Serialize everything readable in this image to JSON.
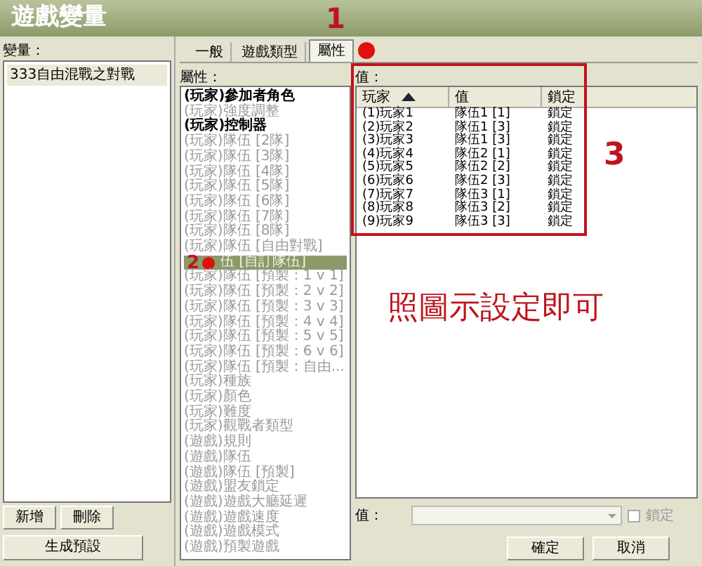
{
  "window": {
    "title": "遊戲變量"
  },
  "variables": {
    "label": "變量：",
    "items": [
      {
        "text": "333自由混戰之對戰",
        "selected": true
      }
    ],
    "buttons": [
      "新增",
      "刪除"
    ],
    "generate_button": "生成預設"
  },
  "tabs": [
    {
      "label": "一般",
      "selected": false
    },
    {
      "label": "遊戲類型",
      "selected": false
    },
    {
      "label": "屬性",
      "selected": true
    }
  ],
  "properties": {
    "label": "屬性：",
    "items": [
      {
        "text": "(玩家)參加者角色",
        "disabled": false,
        "selected": false
      },
      {
        "text": "(玩家)強度調整",
        "disabled": true,
        "selected": false
      },
      {
        "text": "(玩家)控制器",
        "disabled": false,
        "selected": false
      },
      {
        "text": "(玩家)隊伍 [2隊]",
        "disabled": true,
        "selected": false
      },
      {
        "text": "(玩家)隊伍 [3隊]",
        "disabled": true,
        "selected": false
      },
      {
        "text": "(玩家)隊伍 [4隊]",
        "disabled": true,
        "selected": false
      },
      {
        "text": "(玩家)隊伍 [5隊]",
        "disabled": true,
        "selected": false
      },
      {
        "text": "(玩家)隊伍 [6隊]",
        "disabled": true,
        "selected": false
      },
      {
        "text": "(玩家)隊伍 [7隊]",
        "disabled": true,
        "selected": false
      },
      {
        "text": "(玩家)隊伍 [8隊]",
        "disabled": true,
        "selected": false
      },
      {
        "text": "(玩家)隊伍 [自由對戰]",
        "disabled": true,
        "selected": false
      },
      {
        "text": "伍 [自訂隊伍]",
        "disabled": true,
        "selected": true
      },
      {
        "text": "(玩家)隊伍 [預製：1 v 1]",
        "disabled": true,
        "selected": false
      },
      {
        "text": "(玩家)隊伍 [預製：2 v 2]",
        "disabled": true,
        "selected": false
      },
      {
        "text": "(玩家)隊伍 [預製：3 v 3]",
        "disabled": true,
        "selected": false
      },
      {
        "text": "(玩家)隊伍 [預製：4 v 4]",
        "disabled": true,
        "selected": false
      },
      {
        "text": "(玩家)隊伍 [預製：5 v 5]",
        "disabled": true,
        "selected": false
      },
      {
        "text": "(玩家)隊伍 [預製：6 v 6]",
        "disabled": true,
        "selected": false
      },
      {
        "text": "(玩家)隊伍 [預製：自由...",
        "disabled": true,
        "selected": false
      },
      {
        "text": "(玩家)種族",
        "disabled": true,
        "selected": false
      },
      {
        "text": "(玩家)顏色",
        "disabled": true,
        "selected": false
      },
      {
        "text": "(玩家)難度",
        "disabled": true,
        "selected": false
      },
      {
        "text": "(玩家)觀戰者類型",
        "disabled": true,
        "selected": false
      },
      {
        "text": "(遊戲)規則",
        "disabled": true,
        "selected": false
      },
      {
        "text": "(遊戲)隊伍",
        "disabled": true,
        "selected": false
      },
      {
        "text": "(遊戲)隊伍 [預製]",
        "disabled": true,
        "selected": false
      },
      {
        "text": "(遊戲)盟友鎖定",
        "disabled": true,
        "selected": false
      },
      {
        "text": "(遊戲)遊戲大廳延遲",
        "disabled": true,
        "selected": false
      },
      {
        "text": "(遊戲)遊戲速度",
        "disabled": true,
        "selected": false
      },
      {
        "text": "(遊戲)遊戲模式",
        "disabled": true,
        "selected": false
      },
      {
        "text": "(遊戲)預製遊戲",
        "disabled": true,
        "selected": false
      }
    ]
  },
  "values": {
    "label": "值：",
    "columns": [
      "玩家",
      "值",
      "鎖定"
    ],
    "rows": [
      [
        "(1)玩家1",
        "隊伍1 [1]",
        "鎖定"
      ],
      [
        "(2)玩家2",
        "隊伍1 [3]",
        "鎖定"
      ],
      [
        "(3)玩家3",
        "隊伍1 [3]",
        "鎖定"
      ],
      [
        "(4)玩家4",
        "隊伍2 [1]",
        "鎖定"
      ],
      [
        "(5)玩家5",
        "隊伍2 [2]",
        "鎖定"
      ],
      [
        "(6)玩家6",
        "隊伍2 [3]",
        "鎖定"
      ],
      [
        "(7)玩家7",
        "隊伍3 [1]",
        "鎖定"
      ],
      [
        "(8)玩家8",
        "隊伍3 [2]",
        "鎖定"
      ],
      [
        "(9)玩家9",
        "隊伍3 [3]",
        "鎖定"
      ]
    ]
  },
  "value_editor": {
    "label": "值：",
    "lock_label": "鎖定",
    "lock_checked": false
  },
  "dialog_buttons": [
    "確定",
    "取消"
  ],
  "annotations": {
    "markers": [
      "1",
      "2",
      "3"
    ],
    "note": "照圖示設定即可"
  }
}
